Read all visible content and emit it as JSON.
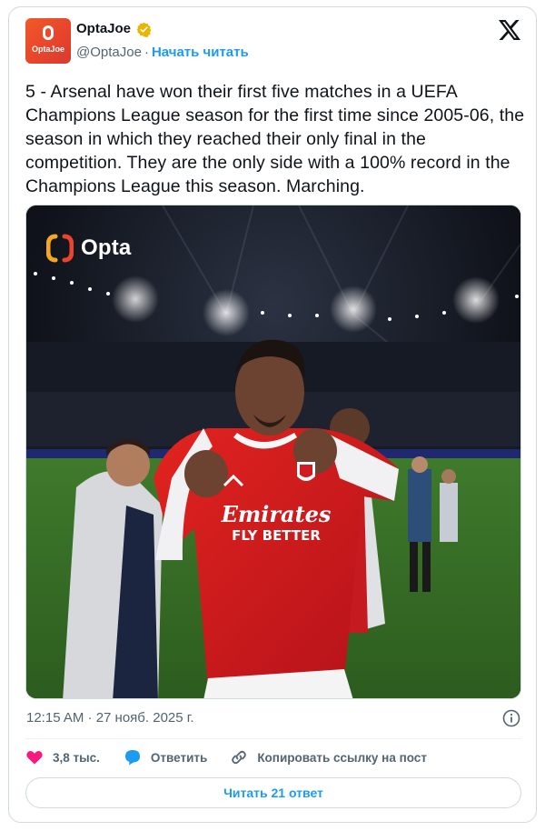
{
  "author": {
    "display_name": "OptaJoe",
    "handle": "@OptaJoe",
    "follow_label": "Начать читать",
    "avatar_text": "OptaJoe",
    "avatar_colors": {
      "top": "#f05a28",
      "bottom": "#d93a2f"
    },
    "verified_badge_color": "#e8b500"
  },
  "platform_icon": "x-logo-icon",
  "tweet": {
    "text": "5 - Arsenal have won their first five matches in a UEFA Champions League season for the first time since 2005-06, the season in which they reached their only final in the competition. They are the only side with a 100% record in the Champions League this season. Marching.",
    "timestamp": "12:15 AM · 27 нояб. 2025 г."
  },
  "media": {
    "watermark": "Opta",
    "kit_sponsor": [
      "Emirates",
      "FLY BETTER"
    ]
  },
  "actions": {
    "like_count": "3,8 тыс.",
    "reply_label": "Ответить",
    "copy_label": "Копировать ссылку на пост"
  },
  "read_replies_label": "Читать 21 ответ",
  "colors": {
    "accent": "#1d9bf0",
    "like": "#f91880",
    "text": "#0f1419",
    "muted": "#536471",
    "border": "#cfd9de"
  }
}
